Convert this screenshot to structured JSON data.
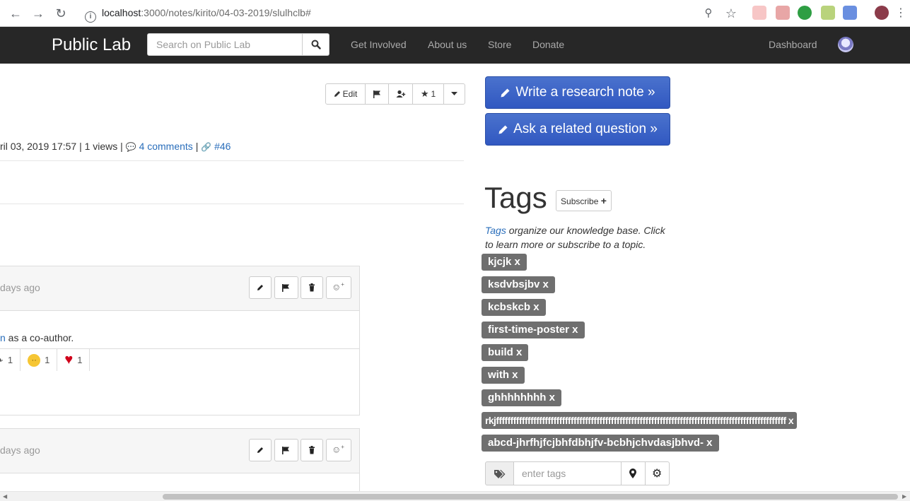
{
  "browser": {
    "url_host": "localhost",
    "url_path": ":3000/notes/kirito/04-03-2019/slulhclb#"
  },
  "navbar": {
    "brand": "Public Lab",
    "search_placeholder": "Search on Public Lab",
    "links": [
      "Get Involved",
      "About us",
      "Store",
      "Donate"
    ],
    "dashboard": "Dashboard"
  },
  "note": {
    "actions": {
      "edit": "Edit",
      "star_count": "1"
    },
    "meta_date": "ril 03, 2019 17:57 | 1 views | ",
    "comments_link": "4 comments",
    "meta_sep": " | ",
    "ref_link": "#46"
  },
  "comments": [
    {
      "when": "days ago",
      "text_link": "n",
      "text": " as a co-author.",
      "reactions": [
        {
          "icon": "thumbs-up",
          "count": "1"
        },
        {
          "icon": "confused-face",
          "count": "1"
        },
        {
          "icon": "heart",
          "count": "1"
        }
      ]
    },
    {
      "when": "days ago"
    }
  ],
  "sidebar": {
    "research_note": "Write a research note »",
    "ask_question": "Ask a related question »",
    "tags_title": "Tags",
    "subscribe": "Subscribe",
    "tags_desc_link": "Tags",
    "tags_desc": " organize our knowledge base. Click to learn more or subscribe to a topic.",
    "tags": [
      "kjcjk x",
      "ksdvbsjbv x",
      "kcbskcb x",
      "first-time-poster x",
      "build x",
      "with x",
      "ghhhhhhhh x",
      "rkjfffffffffffffffffffffffffffffffffffffffffffffffffffffffffffffffffffffffffffffffffffffffffffffffffffff x",
      "abcd-jhrfhjfcjbhfdbhjfv-bcbhjchvdasjbhvd- x"
    ],
    "tag_input_placeholder": "enter tags"
  },
  "colors": {
    "navbar": "#272727",
    "primary": "#3158c1",
    "tag": "#6f6f6f",
    "link": "#2a6ebb"
  }
}
